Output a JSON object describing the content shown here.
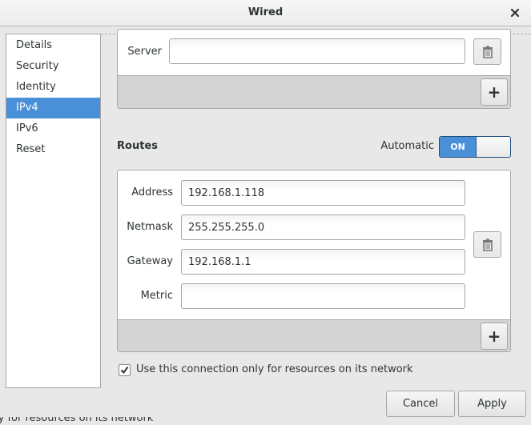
{
  "window": {
    "title": "Wired",
    "close_label": "×"
  },
  "sidebar": {
    "items": [
      {
        "label": "Details",
        "active": false
      },
      {
        "label": "Security",
        "active": false
      },
      {
        "label": "Identity",
        "active": false
      },
      {
        "label": "IPv4",
        "active": true
      },
      {
        "label": "IPv6",
        "active": false
      },
      {
        "label": "Reset",
        "active": false
      }
    ]
  },
  "dns": {
    "server_label": "Server",
    "server_value": "",
    "add_label": "+"
  },
  "routes": {
    "title": "Routes",
    "automatic_label": "Automatic",
    "automatic_state": "ON",
    "address_label": "Address",
    "address_value": "192.168.1.118",
    "netmask_label": "Netmask",
    "netmask_value": "255.255.255.0",
    "gateway_label": "Gateway",
    "gateway_value": "192.168.1.1",
    "metric_label": "Metric",
    "metric_value": "",
    "add_label": "+"
  },
  "options": {
    "only_local_label": "Use this connection only for resources on its network",
    "only_local_checked": true
  },
  "actions": {
    "cancel_label": "Cancel",
    "apply_label": "Apply"
  },
  "background": {
    "bleed_text": "ly for resources on its network"
  }
}
